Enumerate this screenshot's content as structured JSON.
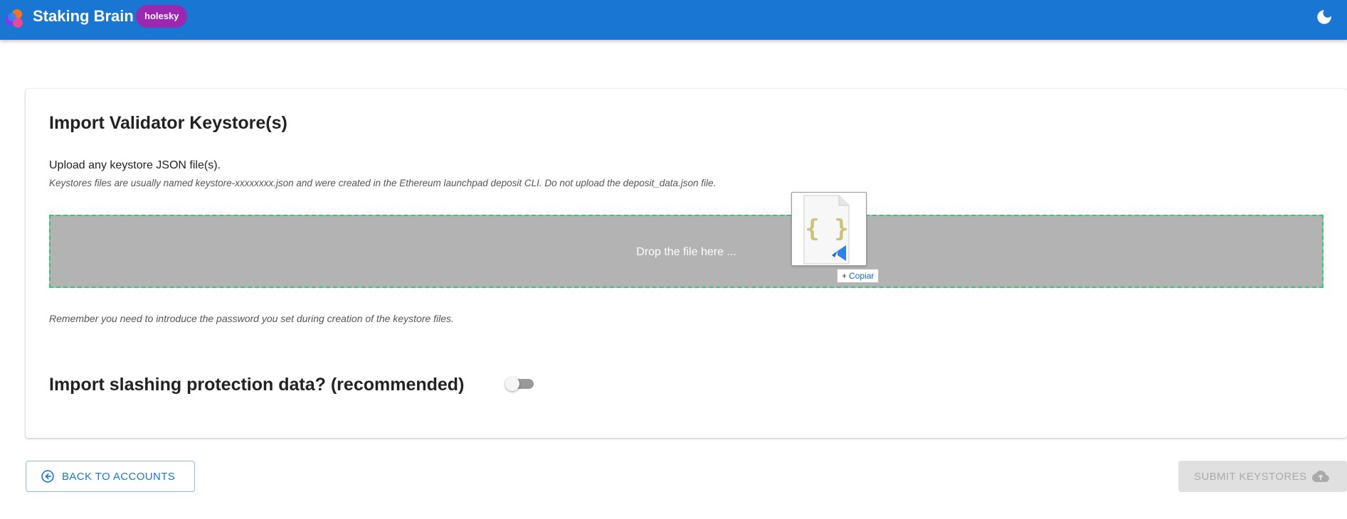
{
  "header": {
    "app_title": "Staking Brain",
    "network_badge": "holesky",
    "theme_icon": "moon-icon",
    "logo_icon": "staking-brain-logo-icon"
  },
  "card": {
    "title": "Import Validator Keystore(s)",
    "upload_instruction": "Upload any keystore JSON file(s).",
    "upload_hint": "Keystores files are usually named keystore-xxxxxxxx.json and were created in the Ethereum launchpad deposit CLI. Do not upload the deposit_data.json file.",
    "dropzone_label": "Drop the file here ...",
    "password_hint": "Remember you need to introduce the password you set during creation of the keystore files.",
    "slashing_title": "Import slashing protection data? (recommended)",
    "slashing_toggle_on": false
  },
  "drag_overlay": {
    "file_icon": "json-file-icon",
    "copy_label": "Copiar",
    "copy_symbol": "+"
  },
  "footer": {
    "back_label": "BACK TO ACCOUNTS",
    "back_icon": "arrow-left-circle-icon",
    "submit_label": "SUBMIT KEYSTORES",
    "submit_icon": "cloud-upload-icon",
    "submit_enabled": false
  },
  "colors": {
    "appbar": "#1976d2",
    "badge": "#9c27b0",
    "dropzone_bg": "#b3b3b3",
    "dropzone_border": "#2ecc71"
  }
}
